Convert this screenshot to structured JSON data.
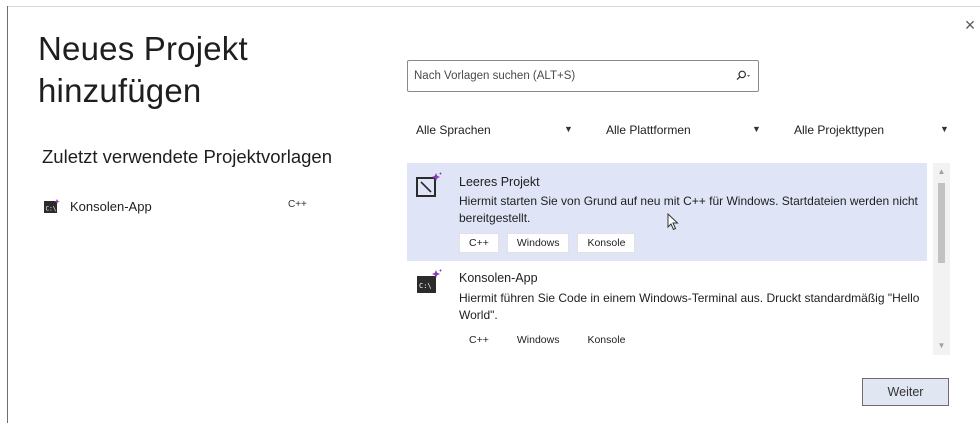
{
  "dialog": {
    "title": "Neues Projekt hinzufügen",
    "close_symbol": "×"
  },
  "recent": {
    "heading": "Zuletzt verwendete Projektvorlagen",
    "items": [
      {
        "icon": "console-app-icon",
        "label": "Konsolen-App",
        "language": "C++"
      }
    ]
  },
  "search": {
    "placeholder": "Nach Vorlagen suchen (ALT+S)",
    "value": "",
    "icon": "search-icon"
  },
  "filters": [
    {
      "label": "Alle Sprachen"
    },
    {
      "label": "Alle Plattformen"
    },
    {
      "label": "Alle Projekttypen"
    }
  ],
  "templates": [
    {
      "icon": "empty-project-icon",
      "name": "Leeres Projekt",
      "description": "Hiermit starten Sie von Grund auf neu mit C++ für Windows. Startdateien werden nicht bereitgestellt.",
      "tags": [
        "C++",
        "Windows",
        "Konsole"
      ],
      "selected": true
    },
    {
      "icon": "console-app-icon",
      "name": "Konsolen-App",
      "description": "Hiermit führen Sie Code in einem Windows-Terminal aus. Druckt standardmäßig \"Hello World\".",
      "tags": [
        "C++",
        "Windows",
        "Konsole"
      ],
      "selected": false
    }
  ],
  "footer": {
    "next_label": "Weiter"
  },
  "colors": {
    "selected_bg": "#dfe4f7",
    "accent_purple": "#8a3db5",
    "button_bg": "#e1e6f3"
  }
}
